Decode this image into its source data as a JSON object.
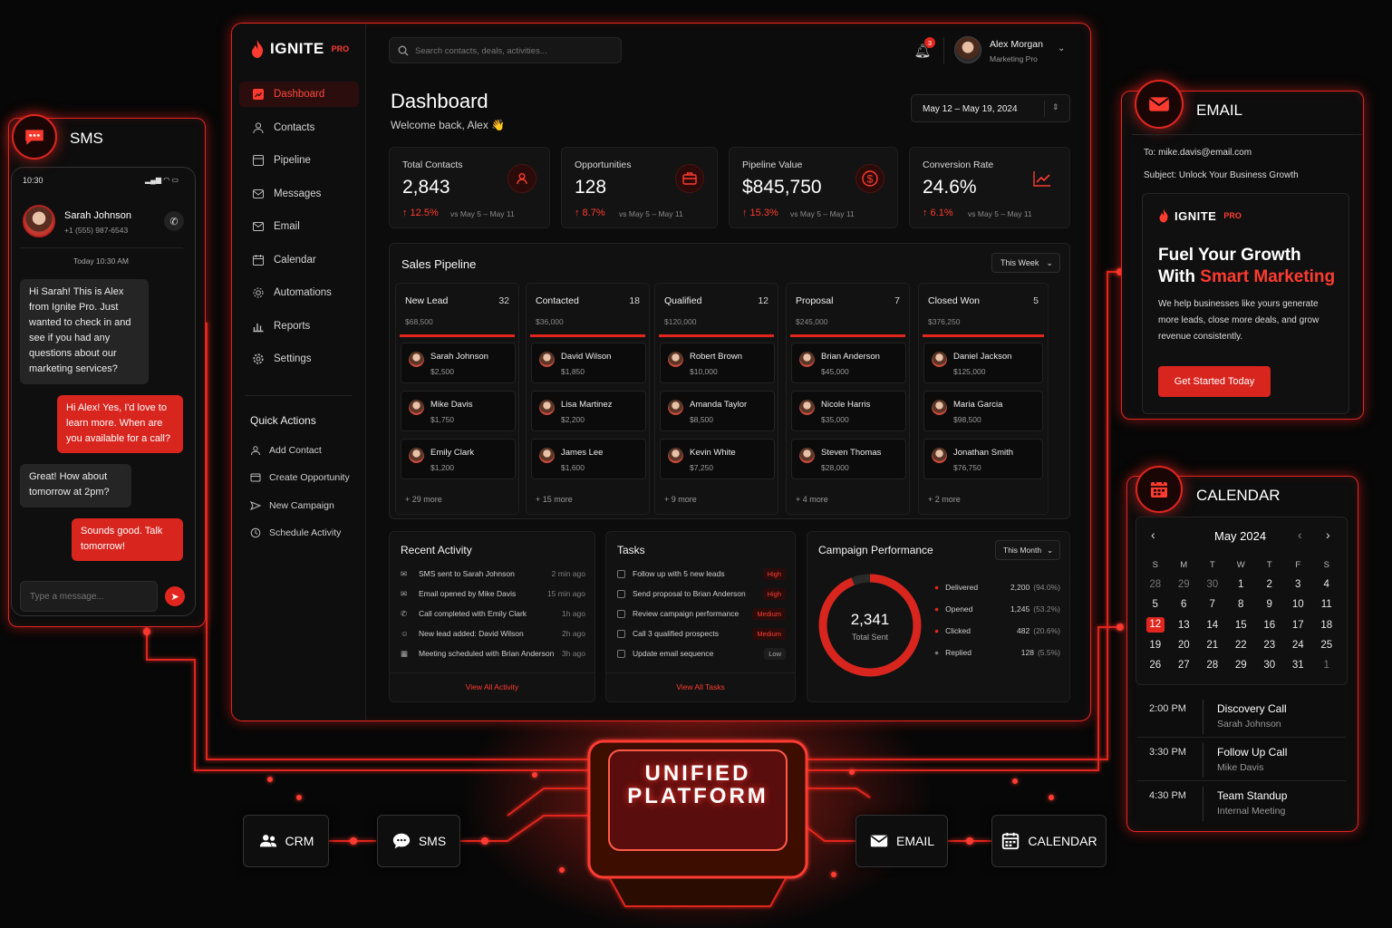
{
  "dashboard": {
    "brand": {
      "name": "IGNITE",
      "suffix": "PRO"
    },
    "search_placeholder": "Search contacts, deals, activities...",
    "notifications": "3",
    "user": {
      "name": "Alex Morgan",
      "role": "Marketing Pro"
    },
    "nav": [
      "Dashboard",
      "Contacts",
      "Pipeline",
      "Messages",
      "Email",
      "Calendar",
      "Automations",
      "Reports",
      "Settings"
    ],
    "quick_actions": {
      "title": "Quick Actions",
      "items": [
        "Add Contact",
        "Create Opportunity",
        "New Campaign",
        "Schedule Activity"
      ]
    },
    "title": "Dashboard",
    "welcome": "Welcome back, Alex 👋",
    "date_range": "May 12 – May 19, 2024",
    "kpis": [
      {
        "label": "Total Contacts",
        "value": "2,843",
        "change": "↑ 12.5%",
        "sub": "vs May 5 – May 11"
      },
      {
        "label": "Opportunities",
        "value": "128",
        "change": "↑ 8.7%",
        "sub": "vs May 5 – May 11"
      },
      {
        "label": "Pipeline Value",
        "value": "$845,750",
        "change": "↑ 15.3%",
        "sub": "vs May 5 – May 11"
      },
      {
        "label": "Conversion Rate",
        "value": "24.6%",
        "change": "↑ 6.1%",
        "sub": "vs May 5 – May 11"
      }
    ],
    "pipeline": {
      "title": "Sales Pipeline",
      "filter": "This Week",
      "stages": [
        {
          "name": "New Lead",
          "count": "32",
          "amount": "$68,500",
          "more": "+ 29 more",
          "deals": [
            {
              "name": "Sarah Johnson",
              "amount": "$2,500"
            },
            {
              "name": "Mike Davis",
              "amount": "$1,750"
            },
            {
              "name": "Emily Clark",
              "amount": "$1,200"
            }
          ]
        },
        {
          "name": "Contacted",
          "count": "18",
          "amount": "$36,000",
          "more": "+ 15 more",
          "deals": [
            {
              "name": "David Wilson",
              "amount": "$1,850"
            },
            {
              "name": "Lisa Martinez",
              "amount": "$2,200"
            },
            {
              "name": "James Lee",
              "amount": "$1,600"
            }
          ]
        },
        {
          "name": "Qualified",
          "count": "12",
          "amount": "$120,000",
          "more": "+ 9 more",
          "deals": [
            {
              "name": "Robert Brown",
              "amount": "$10,000"
            },
            {
              "name": "Amanda Taylor",
              "amount": "$8,500"
            },
            {
              "name": "Kevin White",
              "amount": "$7,250"
            }
          ]
        },
        {
          "name": "Proposal",
          "count": "7",
          "amount": "$245,000",
          "more": "+ 4 more",
          "deals": [
            {
              "name": "Brian Anderson",
              "amount": "$45,000"
            },
            {
              "name": "Nicole Harris",
              "amount": "$35,000"
            },
            {
              "name": "Steven Thomas",
              "amount": "$28,000"
            }
          ]
        },
        {
          "name": "Closed Won",
          "count": "5",
          "amount": "$376,250",
          "more": "+ 2 more",
          "deals": [
            {
              "name": "Daniel Jackson",
              "amount": "$125,000"
            },
            {
              "name": "Maria Garcia",
              "amount": "$98,500"
            },
            {
              "name": "Jonathan Smith",
              "amount": "$76,750"
            }
          ]
        }
      ]
    },
    "activity": {
      "title": "Recent Activity",
      "link": "View All Activity",
      "items": [
        {
          "text": "SMS sent to Sarah Johnson",
          "time": "2 min ago"
        },
        {
          "text": "Email opened by Mike Davis",
          "time": "15 min ago"
        },
        {
          "text": "Call completed with Emily Clark",
          "time": "1h ago"
        },
        {
          "text": "New lead added: David Wilson",
          "time": "2h ago"
        },
        {
          "text": "Meeting scheduled with Brian Anderson",
          "time": "3h ago"
        }
      ]
    },
    "tasks": {
      "title": "Tasks",
      "link": "View All Tasks",
      "items": [
        {
          "text": "Follow up with 5 new leads",
          "priority": "High"
        },
        {
          "text": "Send proposal to Brian Anderson",
          "priority": "High"
        },
        {
          "text": "Review campaign performance",
          "priority": "Medium"
        },
        {
          "text": "Call 3 qualified prospects",
          "priority": "Medium"
        },
        {
          "text": "Update email sequence",
          "priority": "Low"
        }
      ]
    },
    "campaign": {
      "title": "Campaign Performance",
      "filter": "This Month",
      "total": "2,341",
      "total_label": "Total Sent",
      "rows": [
        {
          "label": "Delivered",
          "value": "2,200",
          "pct": "(94.0%)"
        },
        {
          "label": "Opened",
          "value": "1,245",
          "pct": "(53.2%)"
        },
        {
          "label": "Clicked",
          "value": "482",
          "pct": "(20.6%)"
        },
        {
          "label": "Replied",
          "value": "128",
          "pct": "(5.5%)"
        }
      ]
    }
  },
  "sms": {
    "title": "SMS",
    "time": "10:30",
    "contact": {
      "name": "Sarah Johnson",
      "phone": "+1 (555) 987-6543"
    },
    "date": "Today 10:30 AM",
    "messages": [
      {
        "dir": "in",
        "text": "Hi Sarah! This is Alex from Ignite Pro. Just wanted to check in and see if you had any questions about our marketing services?"
      },
      {
        "dir": "out",
        "text": "Hi Alex! Yes, I'd love to learn more. When are you available for a call?"
      },
      {
        "dir": "in",
        "text": "Great! How about tomorrow at 2pm?"
      },
      {
        "dir": "out",
        "text": "Sounds good. Talk tomorrow!"
      }
    ],
    "input_placeholder": "Type a message..."
  },
  "email": {
    "title": "EMAIL",
    "to": "To: mike.davis@email.com",
    "subject": "Subject: Unlock Your Business Growth",
    "brand": {
      "name": "IGNITE",
      "suffix": "PRO"
    },
    "headline_1": "Fuel Your Growth",
    "headline_2a": "With ",
    "headline_2b": "Smart Marketing",
    "body": "We help businesses like yours generate more leads, close more deals, and grow revenue consistently.",
    "cta": "Get Started Today"
  },
  "calendar": {
    "title": "CALENDAR",
    "month": "May 2024",
    "weekdays": [
      "S",
      "M",
      "T",
      "W",
      "T",
      "F",
      "S"
    ],
    "weeks": [
      [
        "28",
        "29",
        "30",
        "1",
        "2",
        "3",
        "4"
      ],
      [
        "5",
        "6",
        "7",
        "8",
        "9",
        "10",
        "11"
      ],
      [
        "12",
        "13",
        "14",
        "15",
        "16",
        "17",
        "18"
      ],
      [
        "19",
        "20",
        "21",
        "22",
        "23",
        "24",
        "25"
      ],
      [
        "26",
        "27",
        "28",
        "29",
        "30",
        "31",
        "1"
      ]
    ],
    "selected": "12",
    "events": [
      {
        "time": "2:00 PM",
        "title": "Discovery Call",
        "sub": "Sarah Johnson"
      },
      {
        "time": "3:30 PM",
        "title": "Follow Up Call",
        "sub": "Mike Davis"
      },
      {
        "time": "4:30 PM",
        "title": "Team Standup",
        "sub": "Internal Meeting"
      }
    ]
  },
  "platform": {
    "line1": "UNIFIED",
    "line2": "PLATFORM"
  },
  "badges": [
    "CRM",
    "SMS",
    "EMAIL",
    "CALENDAR"
  ],
  "colors": {
    "accent": "#e2261e",
    "background": "#070707",
    "panel": "#121212"
  }
}
